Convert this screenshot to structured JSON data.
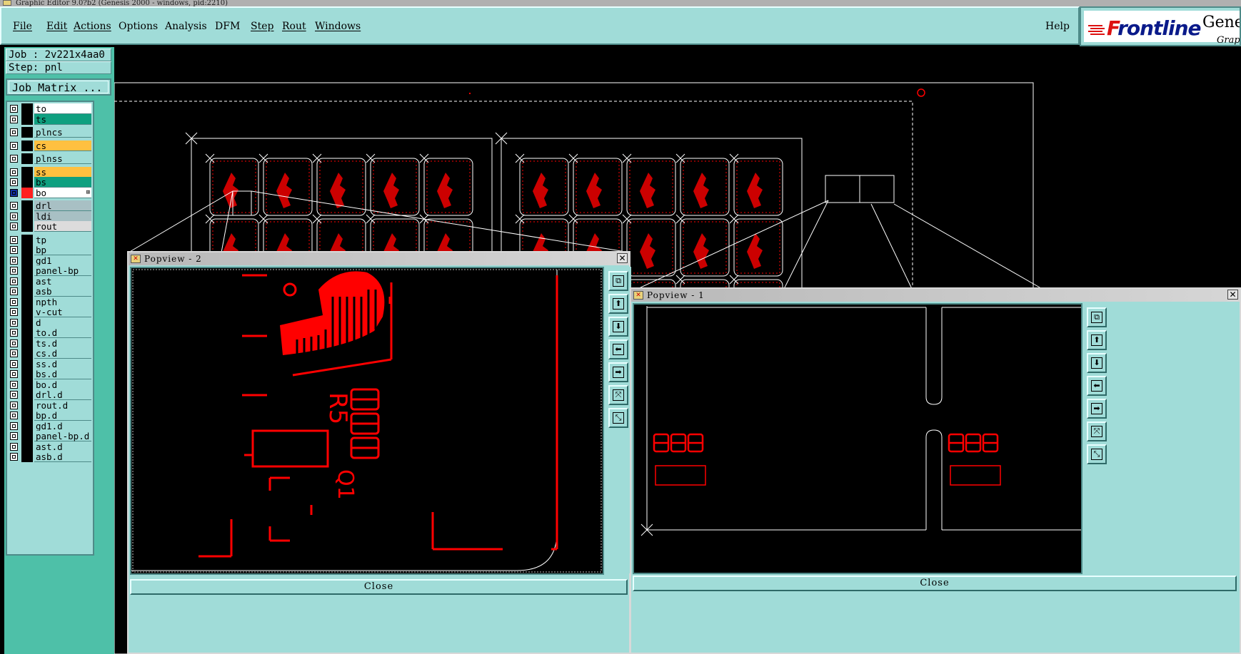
{
  "app": {
    "title": "Graphic Editor 9.0?b2 (Genesis 2000 - windows, pid:2210)"
  },
  "menubar": {
    "items": [
      "File",
      "Edit",
      "Actions",
      "Options",
      "Analysis",
      "DFM",
      "Step",
      "Rout",
      "Windows"
    ],
    "help": "Help"
  },
  "logo": {
    "brand": "Frontline",
    "product": "Genes",
    "subtitle": "Graph"
  },
  "job": {
    "job_line": "Job : 2v221x4aa0",
    "step_line": "Step: pnl",
    "matrix_button": "Job Matrix ..."
  },
  "layers": [
    {
      "name": "to",
      "color": "#ffffff"
    },
    {
      "name": "ts",
      "color": "#0fa080"
    },
    {
      "name": "plncs",
      "color": "#a0dcd8"
    },
    {
      "name": "cs",
      "color": "#ffc040"
    },
    {
      "name": "plnss",
      "color": "#a0dcd8"
    },
    {
      "name": "ss",
      "color": "#ffc040"
    },
    {
      "name": "bs",
      "color": "#0fa080"
    },
    {
      "name": "bo",
      "color": "#ffffff",
      "active": true
    },
    {
      "name": "drl",
      "color": "#a8c0c4"
    },
    {
      "name": "ldi",
      "color": "#a8c0c4"
    },
    {
      "name": "rout",
      "color": "#dcdcdc"
    },
    {
      "name": "tp"
    },
    {
      "name": "bp"
    },
    {
      "name": "gd1"
    },
    {
      "name": "panel-bp"
    },
    {
      "name": "ast"
    },
    {
      "name": "asb"
    },
    {
      "name": "npth"
    },
    {
      "name": "v-cut"
    },
    {
      "name": "d"
    },
    {
      "name": "to.d"
    },
    {
      "name": "ts.d"
    },
    {
      "name": "cs.d"
    },
    {
      "name": "ss.d"
    },
    {
      "name": "bs.d"
    },
    {
      "name": "bo.d"
    },
    {
      "name": "drl.d"
    },
    {
      "name": "rout.d"
    },
    {
      "name": "bp.d"
    },
    {
      "name": "gd1.d"
    },
    {
      "name": "panel-bp.d"
    },
    {
      "name": "ast.d"
    },
    {
      "name": "asb.d"
    }
  ],
  "popview2": {
    "title": "Popview - 2",
    "close_label": "Close",
    "silk_text": [
      "R5",
      "Q1"
    ]
  },
  "popview1": {
    "title": "Popview - 1",
    "close_label": "Close"
  },
  "tools": [
    "zoom-window-icon",
    "pan-up-icon",
    "pan-down-icon",
    "pan-left-icon",
    "pan-right-icon",
    "zoom-in-icon",
    "zoom-out-icon"
  ],
  "colors": {
    "panel_bg": "#a0dcd8",
    "panel_dark": "#4ec0a8",
    "feature": "#ff0000",
    "outline": "#ffffff"
  }
}
